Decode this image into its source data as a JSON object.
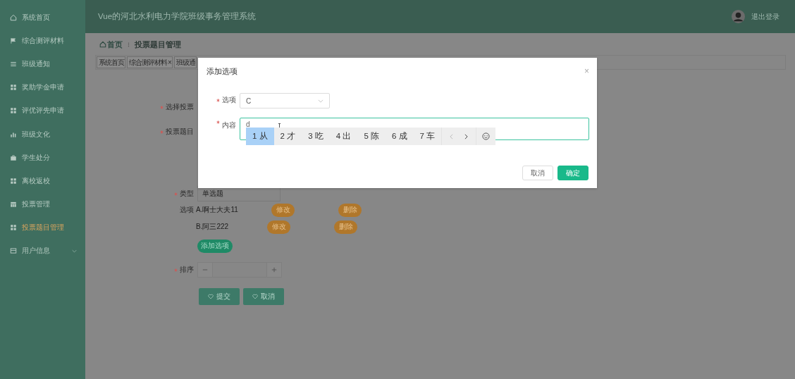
{
  "sidebar": {
    "items": [
      {
        "label": "系统首页",
        "kind": "link",
        "selected": false
      },
      {
        "label": "综合测评材料",
        "kind": "link",
        "selected": false
      },
      {
        "label": "班级通知",
        "kind": "link",
        "selected": false
      },
      {
        "label": "奖助学金申请",
        "kind": "link",
        "selected": false
      },
      {
        "label": "评优评先申请",
        "kind": "link",
        "selected": false
      },
      {
        "label": "班级文化",
        "kind": "link",
        "selected": false
      },
      {
        "label": "学生处分",
        "kind": "link",
        "selected": false
      },
      {
        "label": "离校返校",
        "kind": "link",
        "selected": false
      },
      {
        "label": "投票管理",
        "kind": "link",
        "selected": false
      },
      {
        "label": "投票题目管理",
        "kind": "link",
        "selected": true
      },
      {
        "label": "用户信息",
        "kind": "group",
        "selected": false
      }
    ]
  },
  "header": {
    "title": "Vue的河北水利电力学院班级事务管理系统",
    "logout": "退出登录"
  },
  "breadcrumb": [
    "首页",
    "投票题目管理"
  ],
  "tabs": [
    {
      "label": "系统首页"
    },
    {
      "label": "综合测评材料",
      "close": "×"
    },
    {
      "label": "班级通"
    }
  ],
  "form": {
    "fields": [
      {
        "label": "选择投票",
        "required": true
      },
      {
        "label": "投票题目",
        "required": true
      },
      {
        "label": "类型",
        "required": true,
        "value": "单选题"
      }
    ],
    "options_label": "选项",
    "options": [
      {
        "text": "A.啊士大夫11",
        "edit": "修改",
        "delete": "删除"
      },
      {
        "text": "B.阿三222",
        "edit": "修改",
        "delete": "删除"
      }
    ],
    "add_option": "添加选项",
    "sort": {
      "label": "排序",
      "required": true
    },
    "buttons": [
      "提交",
      "取消"
    ]
  },
  "dialog": {
    "title": "添加选项",
    "close": "×",
    "fields": [
      {
        "label": "选项",
        "required": true,
        "kind": "select",
        "value": "C"
      },
      {
        "label": "内容",
        "required": true,
        "kind": "textarea",
        "value": "d"
      }
    ],
    "buttons": [
      {
        "label": "取消",
        "kind": "default"
      },
      {
        "label": "确定",
        "kind": "primary"
      }
    ]
  },
  "ime": {
    "candidates": [
      {
        "label": "1 从",
        "selected": true
      },
      {
        "label": "2 才",
        "selected": false
      },
      {
        "label": "3 吃",
        "selected": false
      },
      {
        "label": "4 出",
        "selected": false
      },
      {
        "label": "5 陈",
        "selected": false
      },
      {
        "label": "6 成",
        "selected": false
      },
      {
        "label": "7 车",
        "selected": false
      }
    ]
  }
}
